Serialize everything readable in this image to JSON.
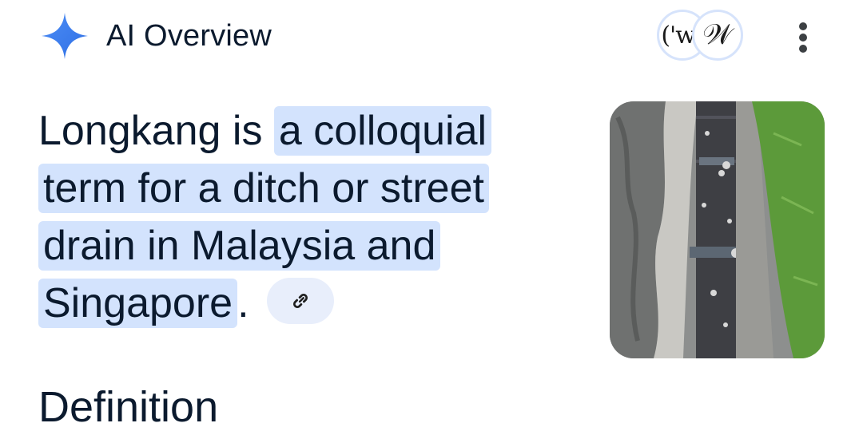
{
  "header": {
    "title": "AI Overview",
    "sources": [
      {
        "label": "('w)",
        "icon": "source-favicon-icon"
      },
      {
        "label": "𝒲",
        "icon": "wikipedia-icon"
      }
    ],
    "menu_icon": "more-vert-icon"
  },
  "answer": {
    "lead": "Longkang is ",
    "highlight": "a colloquial term for a ditch or street drain in Malaysia and Singapore",
    "trail": ".",
    "link_icon": "link-icon"
  },
  "thumbnail": {
    "icon": "street-drain-photo"
  },
  "next_section": {
    "heading": "Definition"
  },
  "colors": {
    "accent_blue": "#3b82f6",
    "highlight_bg": "#d3e3fd",
    "chip_bg": "#e8eefb",
    "text": "#0b1a2e"
  }
}
